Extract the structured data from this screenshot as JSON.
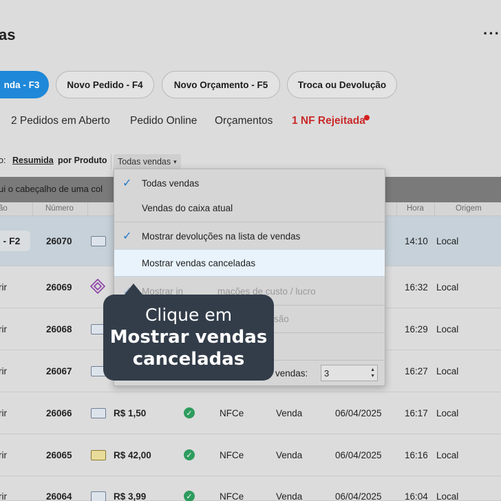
{
  "header": {
    "title_fragment": "as",
    "more_icon": "ellipsis-icon"
  },
  "actions": {
    "nova_venda": "nda - F3",
    "novo_pedido": "Novo Pedido - F4",
    "novo_orcamento": "Novo Orçamento - F5",
    "troca": "Troca ou Devolução"
  },
  "tabs": {
    "pedidos_aberto": "2 Pedidos em Aberto",
    "pedido_online": "Pedido Online",
    "orcamentos": "Orçamentos",
    "nf_rejeitada": "1 NF Rejeitada"
  },
  "filters": {
    "label_fragment": "o:",
    "resumida": "Resumida",
    "por_produto": "por Produto",
    "select_value": "Todas vendas",
    "select_arrow": "▾"
  },
  "group_bar_text": "ui o cabeçalho de uma col",
  "columns": {
    "col0": "ão",
    "numero": "Número",
    "hora": "Hora",
    "origem": "Origem"
  },
  "rows": [
    {
      "action": "- F2",
      "numero": "26070",
      "valor": "",
      "nf": "",
      "tipo": "",
      "data": "",
      "hora": "14:10",
      "origem": "Local"
    },
    {
      "action": "rir",
      "numero": "26069",
      "valor": "",
      "nf": "",
      "tipo": "",
      "data": "",
      "hora": "16:32",
      "origem": "Local"
    },
    {
      "action": "rir",
      "numero": "26068",
      "valor": "",
      "nf": "",
      "tipo": "",
      "data": "",
      "hora": "16:29",
      "origem": "Local"
    },
    {
      "action": "rir",
      "numero": "26067",
      "valor": "",
      "nf": "",
      "tipo": "",
      "data": "",
      "hora": "16:27",
      "origem": "Local"
    },
    {
      "action": "rir",
      "numero": "26066",
      "valor": "R$ 1,50",
      "nf": "NFCe",
      "tipo": "Venda",
      "data": "06/04/2025",
      "hora": "16:17",
      "origem": "Local"
    },
    {
      "action": "rir",
      "numero": "26065",
      "valor": "R$ 42,00",
      "nf": "NFCe",
      "tipo": "Venda",
      "data": "06/04/2025",
      "hora": "16:16",
      "origem": "Local"
    },
    {
      "action": "rir",
      "numero": "26064",
      "valor": "R$ 3,99",
      "nf": "NFCe",
      "tipo": "Venda",
      "data": "06/04/2025",
      "hora": "16:04",
      "origem": "Local"
    }
  ],
  "menu": {
    "todas_vendas": "Todas vendas",
    "vendas_caixa": "Vendas do caixa atual",
    "mostrar_devolucoes": "Mostrar devoluções na lista de vendas",
    "mostrar_canceladas": "Mostrar vendas canceladas",
    "info_custo_left": "Mostrar in",
    "info_custo_right": "mações de custo / lucro",
    "item6_fragment": "são",
    "qtd_label": "vendas:",
    "qtd_value": "3",
    "spin_up": "▲",
    "spin_down": "▼"
  },
  "tooltip": {
    "line1": "Clique em",
    "line2": "Mostrar vendas",
    "line3": "canceladas"
  },
  "check_mark": "✓"
}
